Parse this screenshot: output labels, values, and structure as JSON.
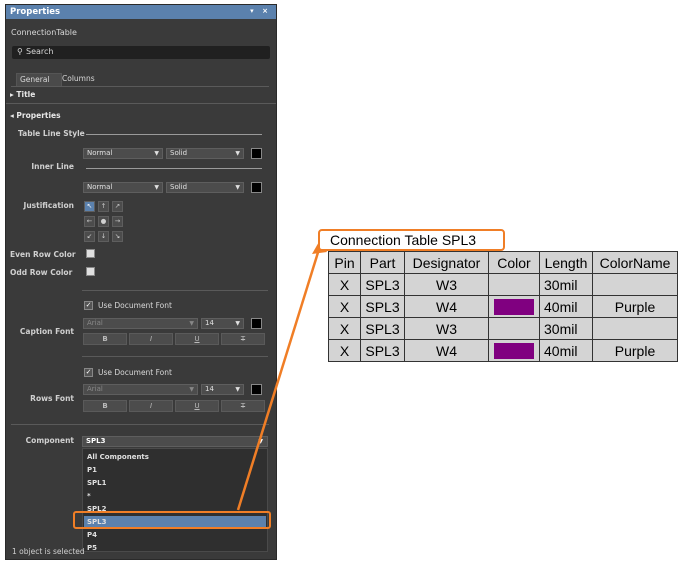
{
  "panel": {
    "title": "Properties",
    "controls": "▾ ×",
    "object_type": "ConnectionTable",
    "search_placeholder": "Search",
    "tabs": [
      "General",
      "Columns"
    ],
    "section_title": "Title",
    "section_properties": "Properties",
    "table_line_style_label": "Table Line Style",
    "inner_line_label": "Inner Line",
    "justification_label": "Justification",
    "even_row_color_label": "Even Row Color",
    "odd_row_color_label": "Odd Row Color",
    "caption_font_label": "Caption Font",
    "rows_font_label": "Rows Font",
    "component_label": "Component",
    "line1": {
      "width": "Normal",
      "style": "Solid",
      "color": "#000000"
    },
    "line2": {
      "width": "Normal",
      "style": "Solid",
      "color": "#000000"
    },
    "justify_arrows": [
      "↖",
      "↑",
      "↗",
      "←",
      "●",
      "→",
      "↙",
      "↓",
      "↘"
    ],
    "caption": {
      "use_doc_font": "Use Document Font",
      "font": "Arial",
      "size": "14",
      "color": "#000000",
      "buttons": [
        "B",
        "I",
        "U",
        "T"
      ]
    },
    "rows": {
      "use_doc_font": "Use Document Font",
      "font": "Arial",
      "size": "14",
      "color": "#000000",
      "buttons": [
        "B",
        "I",
        "U",
        "T"
      ]
    },
    "component_value": "SPL3",
    "component_options": [
      "All Components",
      "P1",
      "SPL1",
      "*",
      "SPL2",
      "SPL3",
      "P4",
      "P5"
    ],
    "component_selected_index": 5,
    "status": "1 object is selected"
  },
  "table": {
    "title": "Connection Table SPL3",
    "headers": [
      "Pin",
      "Part",
      "Designator",
      "Color",
      "Length",
      "ColorName"
    ],
    "rows": [
      {
        "pin": "X",
        "part": "SPL3",
        "designator": "W3",
        "color": "",
        "length": "30mil",
        "colorname": ""
      },
      {
        "pin": "X",
        "part": "SPL3",
        "designator": "W4",
        "color": "#800080",
        "length": "40mil",
        "colorname": "Purple"
      },
      {
        "pin": "X",
        "part": "SPL3",
        "designator": "W3",
        "color": "",
        "length": "30mil",
        "colorname": ""
      },
      {
        "pin": "X",
        "part": "SPL3",
        "designator": "W4",
        "color": "#800080",
        "length": "40mil",
        "colorname": "Purple"
      }
    ]
  },
  "callout_color": "#f07e26"
}
